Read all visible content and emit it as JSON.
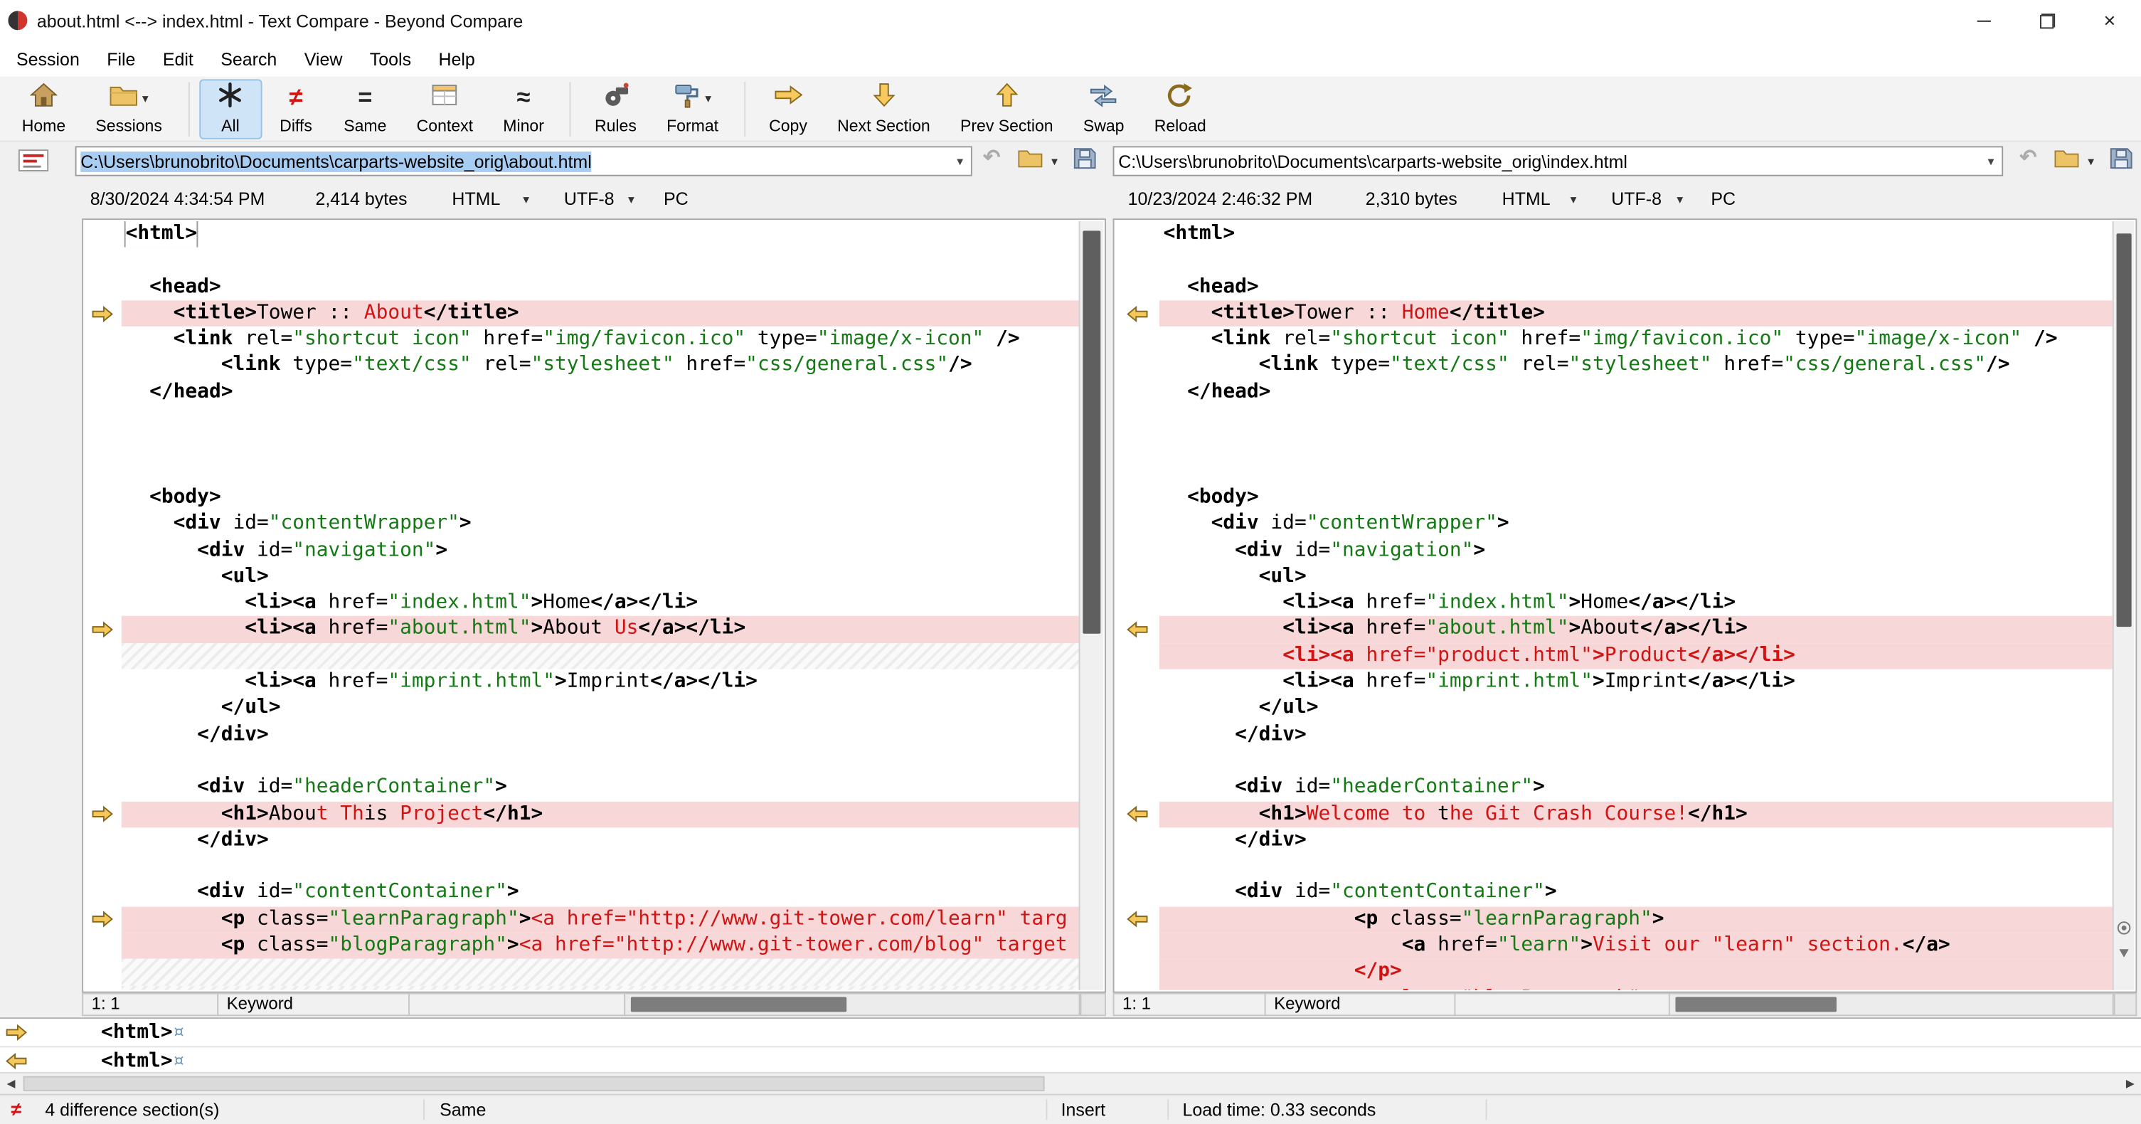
{
  "window": {
    "title": "about.html <--> index.html - Text Compare - Beyond Compare",
    "close_glyph": "×"
  },
  "menu": [
    "Session",
    "File",
    "Edit",
    "Search",
    "View",
    "Tools",
    "Help"
  ],
  "toolbar": [
    {
      "label": "Home",
      "icon": "home-icon"
    },
    {
      "label": "Sessions",
      "icon": "sessions-folder-icon",
      "dropdown": true,
      "sep_after": true
    },
    {
      "label": "All",
      "icon": "all-asterisk-icon",
      "selected": true
    },
    {
      "label": "Diffs",
      "icon": "diffs-icon"
    },
    {
      "label": "Same",
      "icon": "same-icon"
    },
    {
      "label": "Context",
      "icon": "context-icon"
    },
    {
      "label": "Minor",
      "icon": "minor-icon",
      "sep_after": true
    },
    {
      "label": "Rules",
      "icon": "rules-icon"
    },
    {
      "label": "Format",
      "icon": "format-icon",
      "dropdown": true,
      "sep_after": true
    },
    {
      "label": "Copy",
      "icon": "copy-arrow-icon"
    },
    {
      "label": "Next Section",
      "icon": "next-section-icon"
    },
    {
      "label": "Prev Section",
      "icon": "prev-section-icon"
    },
    {
      "label": "Swap",
      "icon": "swap-icon"
    },
    {
      "label": "Reload",
      "icon": "reload-icon"
    }
  ],
  "filebar_icons": [
    "session-type-icon",
    "dropdown-caret-icon",
    "undo-icon",
    "open-folder-icon",
    "save-icon"
  ],
  "left_pane": {
    "path": "C:\\Users\\brunobrito\\Documents\\carparts-website_orig\\about.html",
    "modified": "8/30/2024 4:34:54 PM",
    "size": "2,414 bytes",
    "format": "HTML",
    "encoding": "UTF-8",
    "platform": "PC",
    "cursor": "1: 1",
    "grammar": "Keyword"
  },
  "right_pane": {
    "path": "C:\\Users\\brunobrito\\Documents\\carparts-website_orig\\index.html",
    "modified": "10/23/2024 2:46:32 PM",
    "size": "2,310 bytes",
    "format": "HTML",
    "encoding": "UTF-8",
    "platform": "PC",
    "cursor": "1: 1",
    "grammar": "Keyword"
  },
  "code": {
    "left": [
      {
        "cursor": true,
        "runs": [
          [
            "t",
            "<html>"
          ]
        ]
      },
      {
        "runs": []
      },
      {
        "runs": [
          [
            "p",
            "  "
          ],
          [
            "t",
            "<head>"
          ]
        ]
      },
      {
        "diff": true,
        "arrow": true,
        "runs": [
          [
            "p",
            "    "
          ],
          [
            "t",
            "<title>"
          ],
          [
            "p",
            "Tower :: "
          ],
          [
            "d",
            "About"
          ],
          [
            "t",
            "</title>"
          ]
        ]
      },
      {
        "runs": [
          [
            "p",
            "    "
          ],
          [
            "t",
            "<link"
          ],
          [
            "p",
            " rel="
          ],
          [
            "str",
            "\"shortcut icon\""
          ],
          [
            "p",
            " href="
          ],
          [
            "str",
            "\"img/favicon.ico\""
          ],
          [
            "p",
            " type="
          ],
          [
            "str",
            "\"image/x-icon\""
          ],
          [
            "t",
            " />"
          ]
        ]
      },
      {
        "runs": [
          [
            "p",
            "        "
          ],
          [
            "t",
            "<link"
          ],
          [
            "p",
            " type="
          ],
          [
            "str",
            "\"text/css\""
          ],
          [
            "p",
            " rel="
          ],
          [
            "str",
            "\"stylesheet\""
          ],
          [
            "p",
            " href="
          ],
          [
            "str",
            "\"css/general.css\""
          ],
          [
            "t",
            "/>"
          ]
        ]
      },
      {
        "runs": [
          [
            "p",
            "  "
          ],
          [
            "t",
            "</head>"
          ]
        ]
      },
      {
        "runs": []
      },
      {
        "runs": []
      },
      {
        "runs": []
      },
      {
        "runs": [
          [
            "p",
            "  "
          ],
          [
            "t",
            "<body>"
          ]
        ]
      },
      {
        "runs": [
          [
            "p",
            "    "
          ],
          [
            "t",
            "<div"
          ],
          [
            "p",
            " id="
          ],
          [
            "str",
            "\"contentWrapper\""
          ],
          [
            "t",
            ">"
          ]
        ]
      },
      {
        "runs": [
          [
            "p",
            "      "
          ],
          [
            "t",
            "<div"
          ],
          [
            "p",
            " id="
          ],
          [
            "str",
            "\"navigation\""
          ],
          [
            "t",
            ">"
          ]
        ]
      },
      {
        "runs": [
          [
            "p",
            "        "
          ],
          [
            "t",
            "<ul>"
          ]
        ]
      },
      {
        "runs": [
          [
            "p",
            "          "
          ],
          [
            "t",
            "<li><a"
          ],
          [
            "p",
            " href="
          ],
          [
            "str",
            "\"index.html\""
          ],
          [
            "t",
            ">"
          ],
          [
            "p",
            "Home"
          ],
          [
            "t",
            "</a></li>"
          ]
        ]
      },
      {
        "diff": true,
        "arrow": true,
        "runs": [
          [
            "p",
            "          "
          ],
          [
            "t",
            "<li><a"
          ],
          [
            "p",
            " href="
          ],
          [
            "str",
            "\"about.html\""
          ],
          [
            "t",
            ">"
          ],
          [
            "p",
            "About"
          ],
          [
            "d",
            " Us"
          ],
          [
            "t",
            "</a></li>"
          ]
        ]
      },
      {
        "gap": true,
        "runs": []
      },
      {
        "runs": [
          [
            "p",
            "          "
          ],
          [
            "t",
            "<li><a"
          ],
          [
            "p",
            " href="
          ],
          [
            "str",
            "\"imprint.html\""
          ],
          [
            "t",
            ">"
          ],
          [
            "p",
            "Imprint"
          ],
          [
            "t",
            "</a></li>"
          ]
        ]
      },
      {
        "runs": [
          [
            "p",
            "        "
          ],
          [
            "t",
            "</ul>"
          ]
        ]
      },
      {
        "runs": [
          [
            "p",
            "      "
          ],
          [
            "t",
            "</div>"
          ]
        ]
      },
      {
        "runs": []
      },
      {
        "runs": [
          [
            "p",
            "      "
          ],
          [
            "t",
            "<div"
          ],
          [
            "p",
            " id="
          ],
          [
            "str",
            "\"headerContainer\""
          ],
          [
            "t",
            ">"
          ]
        ]
      },
      {
        "diff": true,
        "arrow": true,
        "runs": [
          [
            "p",
            "        "
          ],
          [
            "t",
            "<h1>"
          ],
          [
            "p",
            "Abou"
          ],
          [
            "d",
            "t Th"
          ],
          [
            "p",
            "is"
          ],
          [
            "d",
            " Project"
          ],
          [
            "t",
            "</h1>"
          ]
        ]
      },
      {
        "runs": [
          [
            "p",
            "      "
          ],
          [
            "t",
            "</div>"
          ]
        ]
      },
      {
        "runs": []
      },
      {
        "runs": [
          [
            "p",
            "      "
          ],
          [
            "t",
            "<div"
          ],
          [
            "p",
            " id="
          ],
          [
            "str",
            "\"contentContainer\""
          ],
          [
            "t",
            ">"
          ]
        ]
      },
      {
        "diff": true,
        "arrow": true,
        "runs": [
          [
            "p",
            "        "
          ],
          [
            "t",
            "<p"
          ],
          [
            "p",
            " class="
          ],
          [
            "str",
            "\"learnParagraph\""
          ],
          [
            "t",
            ">"
          ],
          [
            "d",
            "<a href=\"http://www.git-tower.com/learn\" targ"
          ]
        ]
      },
      {
        "diff": true,
        "runs": [
          [
            "p",
            "        "
          ],
          [
            "t",
            "<p"
          ],
          [
            "p",
            " class="
          ],
          [
            "str",
            "\"blogParagraph\""
          ],
          [
            "t",
            ">"
          ],
          [
            "d",
            "<a href=\"http://www.git-tower.com/blog\" target"
          ]
        ]
      },
      {
        "gap": true,
        "runs": []
      },
      {
        "gap": true,
        "runs": []
      }
    ],
    "right": [
      {
        "runs": [
          [
            "t",
            "<html>"
          ]
        ]
      },
      {
        "runs": []
      },
      {
        "runs": [
          [
            "p",
            "  "
          ],
          [
            "t",
            "<head>"
          ]
        ]
      },
      {
        "diff": true,
        "arrow": true,
        "runs": [
          [
            "p",
            "    "
          ],
          [
            "t",
            "<title>"
          ],
          [
            "p",
            "Tower :: "
          ],
          [
            "d",
            "Home"
          ],
          [
            "t",
            "</title>"
          ]
        ]
      },
      {
        "runs": [
          [
            "p",
            "    "
          ],
          [
            "t",
            "<link"
          ],
          [
            "p",
            " rel="
          ],
          [
            "str",
            "\"shortcut icon\""
          ],
          [
            "p",
            " href="
          ],
          [
            "str",
            "\"img/favicon.ico\""
          ],
          [
            "p",
            " type="
          ],
          [
            "str",
            "\"image/x-icon\""
          ],
          [
            "t",
            " />"
          ]
        ]
      },
      {
        "runs": [
          [
            "p",
            "        "
          ],
          [
            "t",
            "<link"
          ],
          [
            "p",
            " type="
          ],
          [
            "str",
            "\"text/css\""
          ],
          [
            "p",
            " rel="
          ],
          [
            "str",
            "\"stylesheet\""
          ],
          [
            "p",
            " href="
          ],
          [
            "str",
            "\"css/general.css\""
          ],
          [
            "t",
            "/>"
          ]
        ]
      },
      {
        "runs": [
          [
            "p",
            "  "
          ],
          [
            "t",
            "</head>"
          ]
        ]
      },
      {
        "runs": []
      },
      {
        "runs": []
      },
      {
        "runs": []
      },
      {
        "runs": [
          [
            "p",
            "  "
          ],
          [
            "t",
            "<body>"
          ]
        ]
      },
      {
        "runs": [
          [
            "p",
            "    "
          ],
          [
            "t",
            "<div"
          ],
          [
            "p",
            " id="
          ],
          [
            "str",
            "\"contentWrapper\""
          ],
          [
            "t",
            ">"
          ]
        ]
      },
      {
        "runs": [
          [
            "p",
            "      "
          ],
          [
            "t",
            "<div"
          ],
          [
            "p",
            " id="
          ],
          [
            "str",
            "\"navigation\""
          ],
          [
            "t",
            ">"
          ]
        ]
      },
      {
        "runs": [
          [
            "p",
            "        "
          ],
          [
            "t",
            "<ul>"
          ]
        ]
      },
      {
        "runs": [
          [
            "p",
            "          "
          ],
          [
            "t",
            "<li><a"
          ],
          [
            "p",
            " href="
          ],
          [
            "str",
            "\"index.html\""
          ],
          [
            "t",
            ">"
          ],
          [
            "p",
            "Home"
          ],
          [
            "t",
            "</a></li>"
          ]
        ]
      },
      {
        "diff": true,
        "arrow": true,
        "runs": [
          [
            "p",
            "          "
          ],
          [
            "t",
            "<li><a"
          ],
          [
            "p",
            " href="
          ],
          [
            "str",
            "\"about.html\""
          ],
          [
            "t",
            ">"
          ],
          [
            "p",
            "About"
          ],
          [
            "t",
            "</a></li>"
          ]
        ]
      },
      {
        "diff": true,
        "runs": [
          [
            "p",
            "          "
          ],
          [
            "td",
            "<li><a"
          ],
          [
            "d",
            " href=\"product.html\""
          ],
          [
            "td",
            ">"
          ],
          [
            "d",
            "Product"
          ],
          [
            "td",
            "</a></li>"
          ]
        ]
      },
      {
        "runs": [
          [
            "p",
            "          "
          ],
          [
            "t",
            "<li><a"
          ],
          [
            "p",
            " href="
          ],
          [
            "str",
            "\"imprint.html\""
          ],
          [
            "t",
            ">"
          ],
          [
            "p",
            "Imprint"
          ],
          [
            "t",
            "</a></li>"
          ]
        ]
      },
      {
        "runs": [
          [
            "p",
            "        "
          ],
          [
            "t",
            "</ul>"
          ]
        ]
      },
      {
        "runs": [
          [
            "p",
            "      "
          ],
          [
            "t",
            "</div>"
          ]
        ]
      },
      {
        "runs": []
      },
      {
        "runs": [
          [
            "p",
            "      "
          ],
          [
            "t",
            "<div"
          ],
          [
            "p",
            " id="
          ],
          [
            "str",
            "\"headerContainer\""
          ],
          [
            "t",
            ">"
          ]
        ]
      },
      {
        "diff": true,
        "arrow": true,
        "runs": [
          [
            "p",
            "        "
          ],
          [
            "t",
            "<h1>"
          ],
          [
            "d",
            "Welcome to "
          ],
          [
            "p",
            "t"
          ],
          [
            "d",
            "he Git Crash Course!"
          ],
          [
            "t",
            "</h1>"
          ]
        ]
      },
      {
        "runs": [
          [
            "p",
            "      "
          ],
          [
            "t",
            "</div>"
          ]
        ]
      },
      {
        "runs": []
      },
      {
        "runs": [
          [
            "p",
            "      "
          ],
          [
            "t",
            "<div"
          ],
          [
            "p",
            " id="
          ],
          [
            "str",
            "\"contentContainer\""
          ],
          [
            "t",
            ">"
          ]
        ]
      },
      {
        "diff": true,
        "arrow": true,
        "runs": [
          [
            "p",
            "                "
          ],
          [
            "t",
            "<p"
          ],
          [
            "p",
            " class="
          ],
          [
            "str",
            "\"learnParagraph\""
          ],
          [
            "t",
            ">"
          ]
        ]
      },
      {
        "diff": true,
        "runs": [
          [
            "p",
            "                    "
          ],
          [
            "t",
            "<a"
          ],
          [
            "p",
            " href="
          ],
          [
            "str",
            "\"learn\""
          ],
          [
            "t",
            ">"
          ],
          [
            "d",
            "Visit our \"learn\" section."
          ],
          [
            "t",
            "</a>"
          ]
        ]
      },
      {
        "diff": true,
        "runs": [
          [
            "p",
            "                "
          ],
          [
            "td",
            "</p>"
          ]
        ]
      },
      {
        "diff": true,
        "runs": [
          [
            "p",
            "                "
          ],
          [
            "td",
            "<p"
          ],
          [
            "d",
            " class=\"blogParagraph\">"
          ]
        ]
      }
    ]
  },
  "detail_rows": [
    {
      "dir": "right",
      "text": "<html>",
      "eol": "¤"
    },
    {
      "dir": "left",
      "text": "<html>",
      "eol": "¤"
    }
  ],
  "status": {
    "diff_glyph": "≠",
    "sections": "4 difference section(s)",
    "same": "Same",
    "insert": "Insert",
    "load_time": "Load time: 0.33 seconds"
  },
  "colors": {
    "diff_bg": "#f7d7d7",
    "diff_text": "#d01414",
    "string_text": "#157a15",
    "selection_bg": "#a8cdf2",
    "marker_fill": "#f5c85c",
    "scroll_thumb": "#5f5f5f"
  }
}
